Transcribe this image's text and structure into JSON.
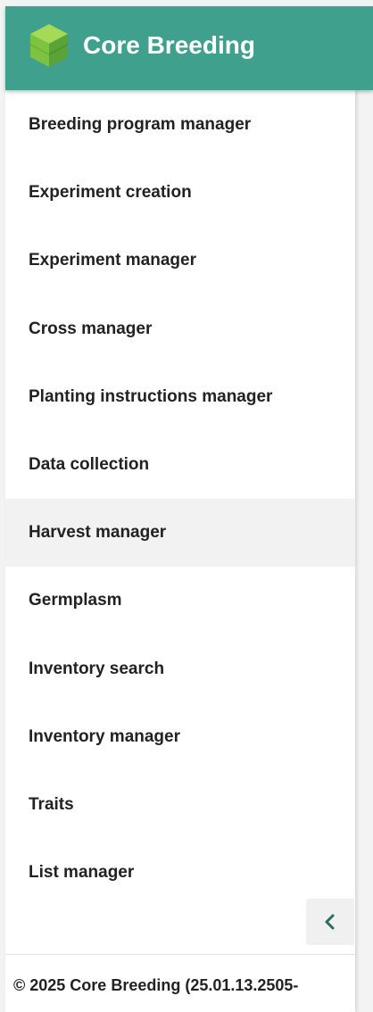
{
  "app": {
    "title": "Core Breeding",
    "logo_icon": "cube-logo-icon",
    "brand_color": "#40a08e"
  },
  "sidebar": {
    "items": [
      {
        "label": "Breeding program manager",
        "active": false
      },
      {
        "label": "Experiment creation",
        "active": false
      },
      {
        "label": "Experiment manager",
        "active": false
      },
      {
        "label": "Cross manager",
        "active": false
      },
      {
        "label": "Planting instructions manager",
        "active": false
      },
      {
        "label": "Data collection",
        "active": false
      },
      {
        "label": "Harvest manager",
        "active": true
      },
      {
        "label": "Germplasm",
        "active": false
      },
      {
        "label": "Inventory search",
        "active": false
      },
      {
        "label": "Inventory manager",
        "active": false
      },
      {
        "label": "Traits",
        "active": false
      },
      {
        "label": "List manager",
        "active": false
      }
    ],
    "collapse_icon": "chevron-left-icon"
  },
  "footer": {
    "text": "© 2025 Core Breeding (25.01.13.2505-"
  }
}
